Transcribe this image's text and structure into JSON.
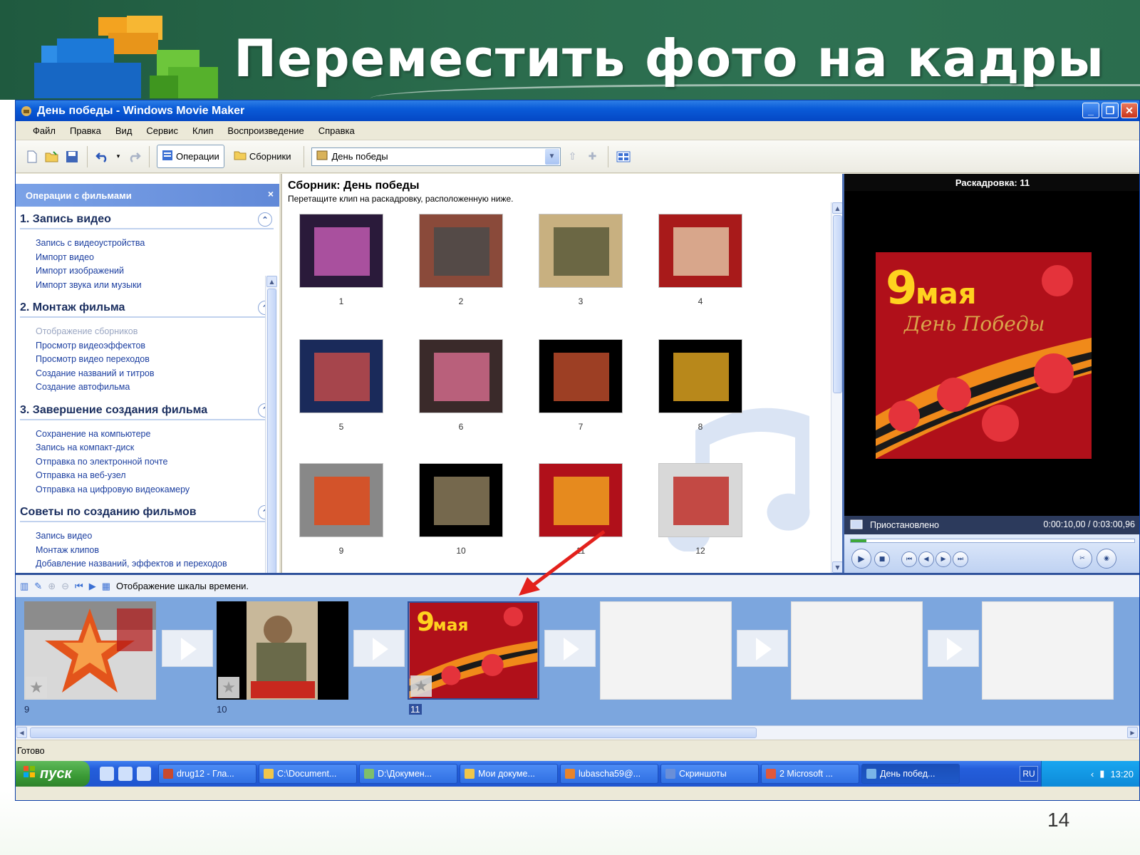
{
  "slide": {
    "title": "Переместить фото на кадры",
    "page_number": "14"
  },
  "window": {
    "title": "День победы - Windows Movie Maker",
    "controls": {
      "minimize": "_",
      "maximize": "❐",
      "close": "✕"
    }
  },
  "menu": [
    "Файл",
    "Правка",
    "Вид",
    "Сервис",
    "Клип",
    "Воспроизведение",
    "Справка"
  ],
  "toolbar": {
    "operations_label": "Операции",
    "collections_label": "Сборники",
    "collection_value": "День победы"
  },
  "tasks": {
    "header": "Операции с фильмами",
    "close": "×",
    "sections": [
      {
        "title": "1. Запись видео",
        "links": [
          {
            "text": "Запись с видеоустройства",
            "disabled": false
          },
          {
            "text": "Импорт видео",
            "disabled": false
          },
          {
            "text": "Импорт изображений",
            "disabled": false
          },
          {
            "text": "Импорт звука или музыки",
            "disabled": false
          }
        ]
      },
      {
        "title": "2. Монтаж фильма",
        "links": [
          {
            "text": "Отображение сборников",
            "disabled": true
          },
          {
            "text": "Просмотр видеоэффектов",
            "disabled": false
          },
          {
            "text": "Просмотр видео переходов",
            "disabled": false
          },
          {
            "text": "Создание названий и титров",
            "disabled": false
          },
          {
            "text": "Создание автофильма",
            "disabled": false
          }
        ]
      },
      {
        "title": "3. Завершение создания фильма",
        "links": [
          {
            "text": "Сохранение на компьютере",
            "disabled": false
          },
          {
            "text": "Запись на компакт-диск",
            "disabled": false
          },
          {
            "text": "Отправка по электронной почте",
            "disabled": false
          },
          {
            "text": "Отправка на веб-узел",
            "disabled": false
          },
          {
            "text": "Отправка на цифровую видеокамеру",
            "disabled": false
          }
        ]
      },
      {
        "title": "Советы по созданию фильмов",
        "links": [
          {
            "text": "Запись видео",
            "disabled": false
          },
          {
            "text": "Монтаж клипов",
            "disabled": false
          },
          {
            "text": "Добавление названий, эффектов и переходов",
            "disabled": false
          }
        ]
      }
    ]
  },
  "collection": {
    "title": "Сборник: День победы",
    "subtitle": "Перетащите клип на раскадровку, расположенную ниже.",
    "clips": [
      "1",
      "2",
      "3",
      "4",
      "5",
      "6",
      "7",
      "8",
      "9",
      "10",
      "11",
      "12"
    ]
  },
  "preview": {
    "title": "Раскадровка: 11",
    "status": "Приостановлено",
    "time": "0:00:10,00 / 0:03:00,96",
    "progress": 0.055
  },
  "storyboard": {
    "toolbar_label": "Отображение шкалы времени.",
    "frames": [
      "9",
      "10",
      "11"
    ]
  },
  "statusbar": {
    "text": "Готово"
  },
  "taskbar": {
    "start": "пуск",
    "tasks": [
      {
        "label": "drug12 - Гла...",
        "color": "#c84a2f"
      },
      {
        "label": "C:\\Document...",
        "color": "#f0c64a"
      },
      {
        "label": "D:\\Докумен...",
        "color": "#7fbf6a"
      },
      {
        "label": "Мои докуме...",
        "color": "#f0c64a"
      },
      {
        "label": "lubascha59@...",
        "color": "#e8842a"
      },
      {
        "label": "Скриншоты",
        "color": "#6a8fd8"
      },
      {
        "label": "2 Microsoft ...",
        "color": "#e0583a"
      },
      {
        "label": "День побед...",
        "color": "#7ab4e8",
        "active": true
      }
    ],
    "lang": "RU",
    "clock": "13:20"
  },
  "colors": {
    "slide_green": "#2a6b4c",
    "xp_blue": "#0a5bd8",
    "storyboard_blue": "#7ca6de",
    "drag_arrow": "#e3211c"
  }
}
